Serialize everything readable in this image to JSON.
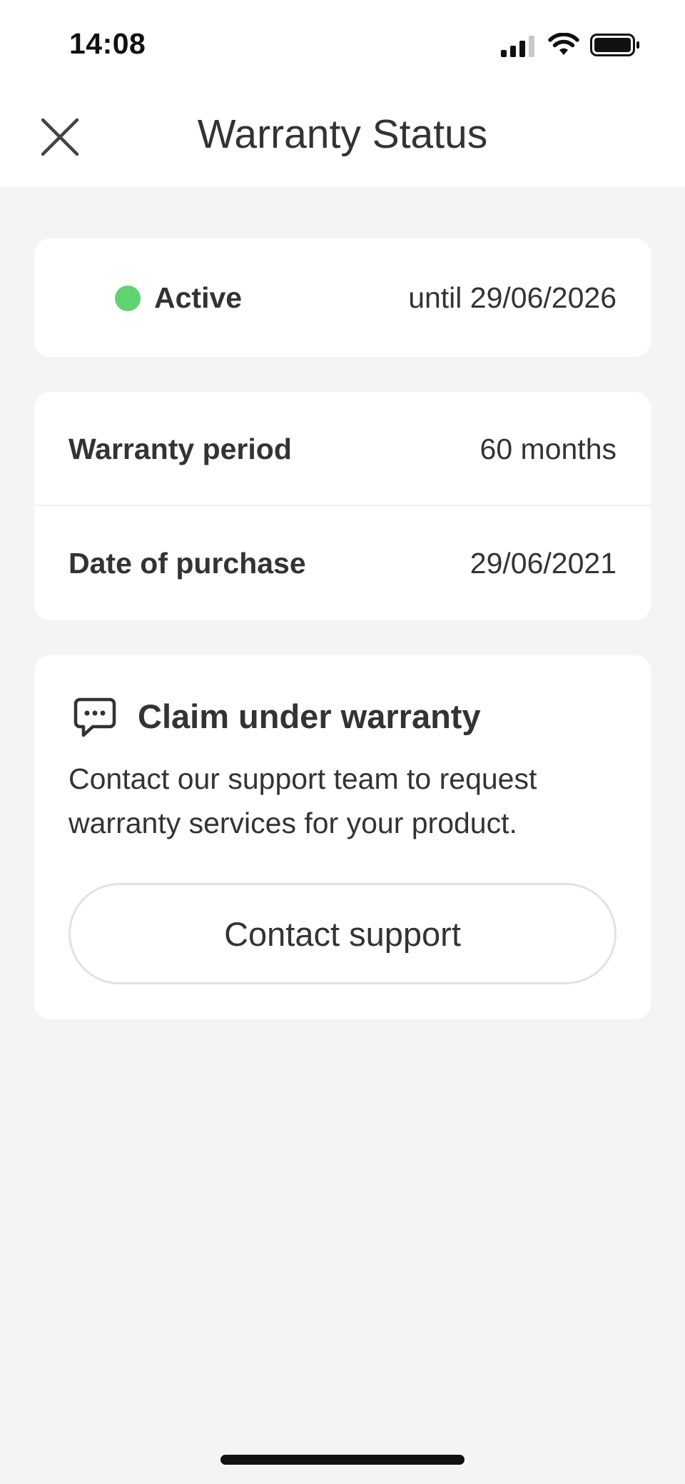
{
  "status_bar": {
    "time": "14:08",
    "icons": [
      "signal-icon",
      "wifi-icon",
      "battery-icon"
    ]
  },
  "header": {
    "title": "Warranty Status",
    "close_icon": "close-icon"
  },
  "status_card": {
    "status": "Active",
    "status_color": "#5ed36f",
    "until": "until 29/06/2026"
  },
  "details": [
    {
      "label": "Warranty period",
      "value": "60 months"
    },
    {
      "label": "Date of purchase",
      "value": "29/06/2021"
    }
  ],
  "claim": {
    "icon": "chat-bubble-icon",
    "title": "Claim under warranty",
    "description": "Contact our support team to request warranty services for your product.",
    "button_label": "Contact support"
  },
  "colors": {
    "background": "#f4f4f4",
    "card": "#ffffff",
    "text": "#333333",
    "active_green": "#5ed36f"
  }
}
